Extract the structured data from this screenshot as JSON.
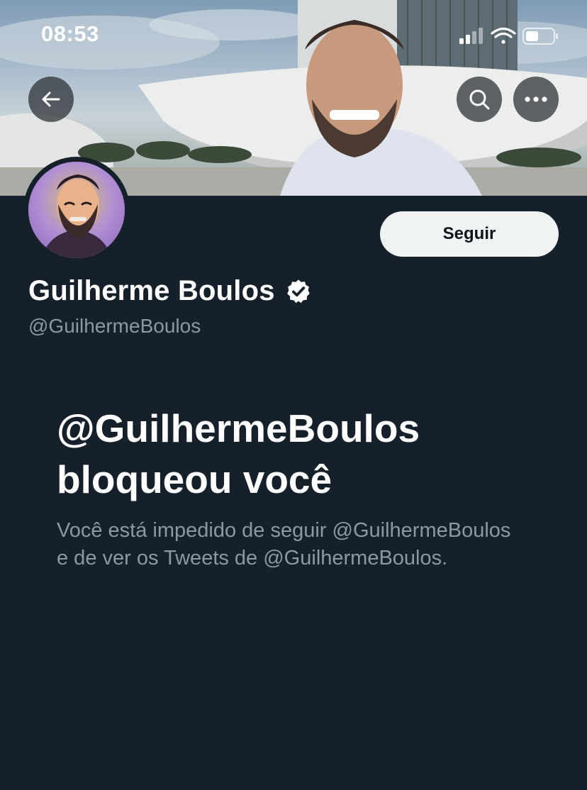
{
  "status_bar": {
    "time": "08:53"
  },
  "header": {
    "back_icon": "arrow-left-icon",
    "search_icon": "search-icon",
    "more_icon": "more-horizontal-icon"
  },
  "profile": {
    "display_name": "Guilherme Boulos",
    "verified_icon": "verified-badge-icon",
    "handle": "@GuilhermeBoulos",
    "follow_label": "Seguir"
  },
  "blocked": {
    "title_line1": "@GuilhermeBoulos",
    "title_line2": "bloqueou você",
    "description": "Você está impedido de seguir @GuilhermeBoulos e de ver os Tweets de @GuilhermeBoulos."
  },
  "colors": {
    "background": "#15202b",
    "follow_button_bg": "#eff3f4",
    "secondary_text": "#8b98a5"
  }
}
